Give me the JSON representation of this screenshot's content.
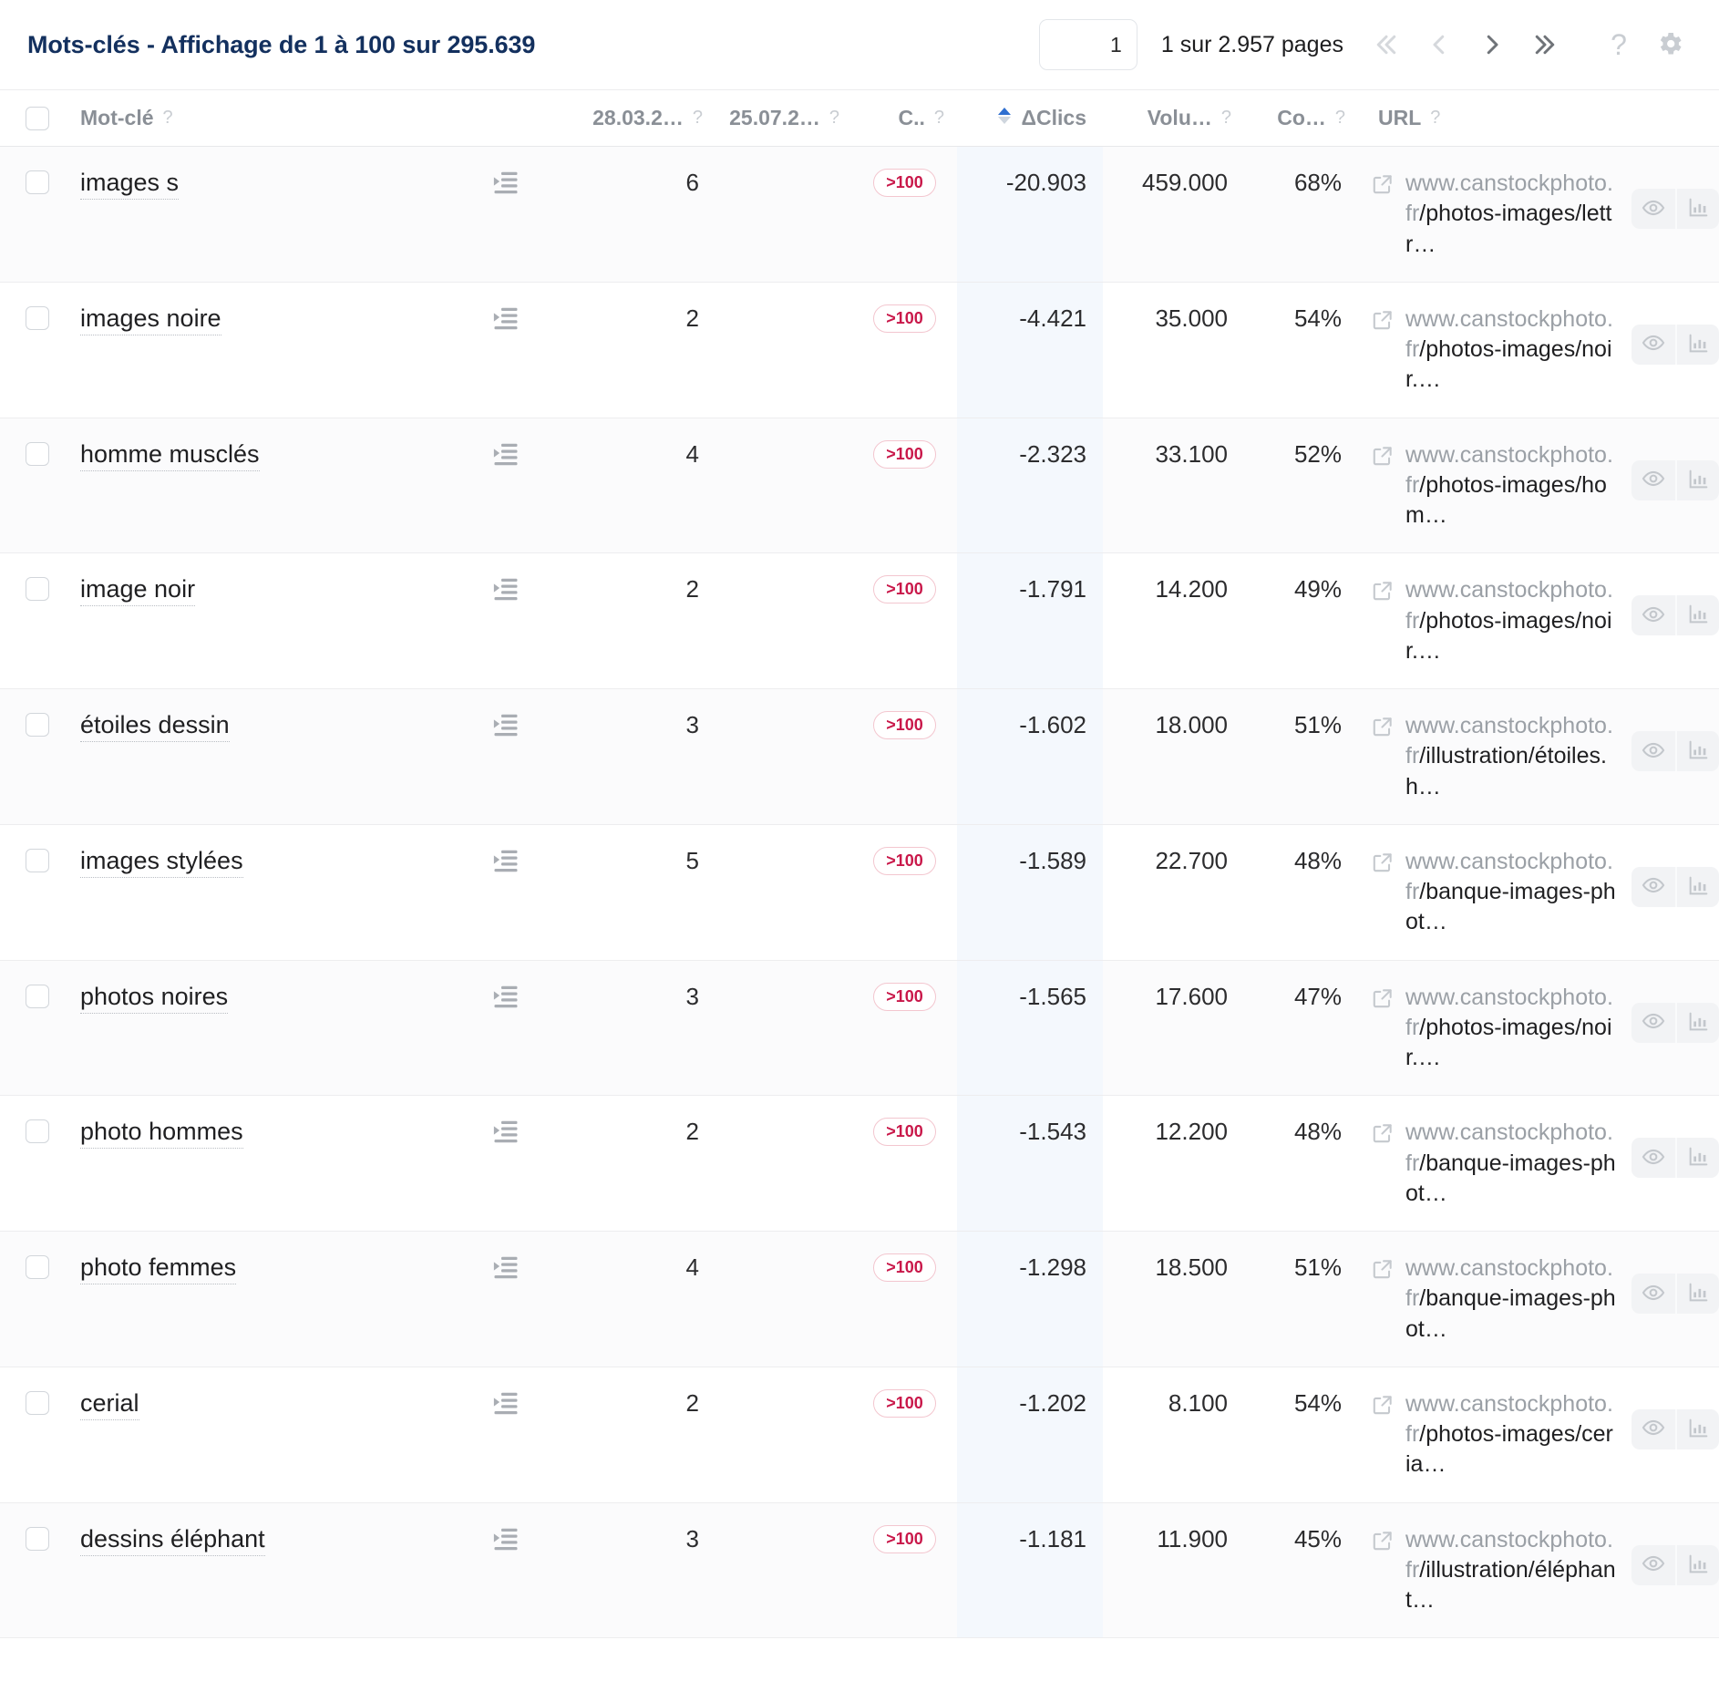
{
  "header": {
    "title": "Mots-clés - Affichage de 1 à 100 sur 295.639",
    "page_input_value": "1",
    "page_input_placeholder": "1",
    "page_count_label": "1 sur 2.957 pages",
    "pager": {
      "first_label": "«",
      "prev_label": "‹",
      "next_label": "›",
      "last_label": "»"
    },
    "help_label": "?",
    "settings_label": "Paramètres"
  },
  "table": {
    "columns": [
      {
        "key": "check",
        "label": "",
        "help": false,
        "align": "left"
      },
      {
        "key": "keyword",
        "label": "Mot-clé",
        "help": true,
        "align": "left"
      },
      {
        "key": "icon",
        "label": "",
        "help": false,
        "align": "left"
      },
      {
        "key": "date1",
        "label": "28.03.2…",
        "help": true,
        "align": "right"
      },
      {
        "key": "date2",
        "label": "25.07.2…",
        "help": true,
        "align": "right"
      },
      {
        "key": "pos",
        "label": "C..",
        "help": true,
        "align": "right"
      },
      {
        "key": "delta",
        "label": "ΔClics",
        "help": false,
        "align": "right",
        "sorted": true,
        "sort_dir": "asc"
      },
      {
        "key": "volume",
        "label": "Volu…",
        "help": true,
        "align": "right"
      },
      {
        "key": "comp",
        "label": "Co…",
        "help": true,
        "align": "right"
      },
      {
        "key": "url",
        "label": "URL",
        "help": true,
        "align": "left"
      }
    ],
    "rows": [
      {
        "keyword": "images s",
        "date1": "6",
        "date2": "",
        "pos_badge": ">100",
        "delta": "-20.903",
        "volume": "459.000",
        "comp": "68%",
        "url_domain": "www.canstockphoto.fr",
        "url_path": "/photos-images/lettr…"
      },
      {
        "keyword": "images noire",
        "date1": "2",
        "date2": "",
        "pos_badge": ">100",
        "delta": "-4.421",
        "volume": "35.000",
        "comp": "54%",
        "url_domain": "www.canstockphoto.fr",
        "url_path": "/photos-images/noir.…"
      },
      {
        "keyword": "homme musclés",
        "date1": "4",
        "date2": "",
        "pos_badge": ">100",
        "delta": "-2.323",
        "volume": "33.100",
        "comp": "52%",
        "url_domain": "www.canstockphoto.fr",
        "url_path": "/photos-images/hom…"
      },
      {
        "keyword": "image noir",
        "date1": "2",
        "date2": "",
        "pos_badge": ">100",
        "delta": "-1.791",
        "volume": "14.200",
        "comp": "49%",
        "url_domain": "www.canstockphoto.fr",
        "url_path": "/photos-images/noir.…"
      },
      {
        "keyword": "étoiles dessin",
        "date1": "3",
        "date2": "",
        "pos_badge": ">100",
        "delta": "-1.602",
        "volume": "18.000",
        "comp": "51%",
        "url_domain": "www.canstockphoto.fr",
        "url_path": "/illustration/étoiles.h…"
      },
      {
        "keyword": "images stylées",
        "date1": "5",
        "date2": "",
        "pos_badge": ">100",
        "delta": "-1.589",
        "volume": "22.700",
        "comp": "48%",
        "url_domain": "www.canstockphoto.fr",
        "url_path": "/banque-images-phot…"
      },
      {
        "keyword": "photos noires",
        "date1": "3",
        "date2": "",
        "pos_badge": ">100",
        "delta": "-1.565",
        "volume": "17.600",
        "comp": "47%",
        "url_domain": "www.canstockphoto.fr",
        "url_path": "/photos-images/noir.…"
      },
      {
        "keyword": "photo hommes",
        "date1": "2",
        "date2": "",
        "pos_badge": ">100",
        "delta": "-1.543",
        "volume": "12.200",
        "comp": "48%",
        "url_domain": "www.canstockphoto.fr",
        "url_path": "/banque-images-phot…"
      },
      {
        "keyword": "photo femmes",
        "date1": "4",
        "date2": "",
        "pos_badge": ">100",
        "delta": "-1.298",
        "volume": "18.500",
        "comp": "51%",
        "url_domain": "www.canstockphoto.fr",
        "url_path": "/banque-images-phot…"
      },
      {
        "keyword": "cerial",
        "date1": "2",
        "date2": "",
        "pos_badge": ">100",
        "delta": "-1.202",
        "volume": "8.100",
        "comp": "54%",
        "url_domain": "www.canstockphoto.fr",
        "url_path": "/photos-images/ceria…"
      },
      {
        "keyword": "dessins éléphant",
        "date1": "3",
        "date2": "",
        "pos_badge": ">100",
        "delta": "-1.181",
        "volume": "11.900",
        "comp": "45%",
        "url_domain": "www.canstockphoto.fr",
        "url_path": "/illustration/éléphant…"
      }
    ]
  },
  "icons": {
    "row_expand": "indent-list-icon",
    "external_link": "external-link-icon",
    "preview": "eye-icon",
    "stats": "bar-chart-icon"
  },
  "colors": {
    "title": "#13305e",
    "badge_text": "#c9184a",
    "badge_border": "#f3c6cf",
    "sorted_column_bg": "#f4f8fd",
    "row_odd_bg": "#fbfbfc",
    "row_even_bg": "#ffffff"
  }
}
